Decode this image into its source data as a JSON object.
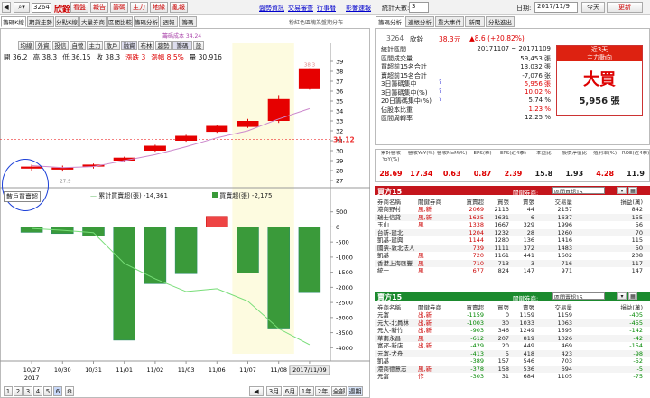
{
  "toolbar": {
    "code": "3264",
    "name": "欣銓",
    "buttons": [
      "看盤",
      "報告",
      "籌碼",
      "主力",
      "地緣",
      "亂報"
    ],
    "links": [
      "盤勢資訊",
      "交易審查",
      "行事曆",
      "影響速報"
    ],
    "days_label": "統計天數:",
    "days": "3",
    "date_label": "日期:",
    "date": "2017/11/9",
    "today": "今天",
    "refresh": "更新"
  },
  "left_tabs": [
    "籌碼K線",
    "期貨走勢",
    "分點K線",
    "大量券商",
    "區間比較",
    "籌碼分析",
    "週報",
    "籌碼"
  ],
  "sub_tabs": [
    "均線",
    "外資",
    "投信",
    "自營",
    "主力",
    "散戶",
    "融資",
    "布林",
    "趨勢",
    "籌碼",
    "設"
  ],
  "ohlc": {
    "open": "開 36.2",
    "high": "高 38.3",
    "low": "低 36.15",
    "close": "收 38.3",
    "change": "漲跌 3",
    "pct": "漲幅 8.5%",
    "vol": "量 30,916"
  },
  "chart_note": "粉紅色區塊為盤期分布",
  "legend_ma": "籌碼成本 34.24",
  "main_y_ticks": [
    "39",
    "38",
    "37",
    "36",
    "35",
    "34",
    "33",
    "32",
    "31",
    "30",
    "29",
    "28",
    "27"
  ],
  "price_marker": "31.12",
  "top_label": "38.3",
  "bottom_label": "27.9",
  "sub_title": "散戶買賣超",
  "sub_leg1": "累計買賣超(張) -14,361",
  "sub_leg2": "買賣超(張) -2,175",
  "sub_y_ticks": [
    "500",
    "0",
    "-500",
    "-1000",
    "-1500",
    "-2000",
    "-2500",
    "-3000",
    "-3500",
    "-4000"
  ],
  "x_labels": [
    "10/27",
    "10/30",
    "10/31",
    "11/01",
    "11/02",
    "11/03",
    "11/06",
    "11/07",
    "11/08",
    "2017/11/09"
  ],
  "x_year": "2017",
  "pages": [
    "1",
    "2",
    "3",
    "4",
    "5",
    "6"
  ],
  "ranges": [
    "3月",
    "6月",
    "1年",
    "2年",
    "全部",
    "週期"
  ],
  "chart_data": [
    {
      "type": "candlestick",
      "x": [
        "10/27",
        "10/30",
        "10/31",
        "11/01",
        "11/02",
        "11/03",
        "11/06",
        "11/07",
        "11/08",
        "11/09"
      ],
      "ohlc": [
        [
          28.4,
          28.6,
          28.0,
          28.2
        ],
        [
          28.3,
          28.5,
          27.9,
          28.1
        ],
        [
          28.4,
          28.7,
          28.2,
          28.6
        ],
        [
          29.0,
          29.4,
          28.9,
          29.3
        ],
        [
          30.0,
          30.6,
          29.9,
          30.5
        ],
        [
          31.0,
          31.6,
          30.9,
          31.5
        ],
        [
          31.9,
          32.6,
          31.8,
          32.5
        ],
        [
          32.4,
          33.2,
          32.3,
          33.0
        ],
        [
          33.0,
          35.6,
          32.8,
          35.2
        ],
        [
          36.2,
          38.3,
          36.15,
          38.3
        ]
      ],
      "ma": [
        28.5,
        28.3,
        28.4,
        29.0,
        29.6,
        30.4,
        31.3,
        32.0,
        33.2,
        34.24
      ],
      "ylim": [
        27,
        39
      ]
    },
    {
      "type": "bar",
      "x": [
        "10/27",
        "10/30",
        "10/31",
        "11/01",
        "11/02",
        "11/03",
        "11/06",
        "11/07",
        "11/08",
        "11/09"
      ],
      "values": [
        -180,
        -220,
        -300,
        -3750,
        -1880,
        -1550,
        350,
        -1520,
        -3350,
        -2175
      ],
      "cumulative": [
        -180,
        -400,
        -700,
        -4450,
        -6330,
        -7880,
        -7530,
        -9050,
        -12400,
        -14361
      ],
      "ylim": [
        -4200,
        700
      ]
    }
  ],
  "info": {
    "tabs": [
      "籌碼分析",
      "連帳分析",
      "重大事件",
      "新聞",
      "分點進出"
    ],
    "code": "3264",
    "name": "欣銓",
    "price": "38.3元",
    "change": "▲8.6 (+20.82%)",
    "rows": [
      [
        "統計區間",
        "20171107 ~ 20171109",
        ""
      ],
      [
        "區間成交量",
        "59,453 張",
        ""
      ],
      [
        "買超前15名合計",
        "13,032 張",
        ""
      ],
      [
        "賣超前15名合計",
        "-7,076 张",
        ""
      ],
      [
        "3日籌碼集中",
        "5,956 張",
        "red"
      ],
      [
        "3日籌碼集中(%)",
        "10.02 %",
        "red"
      ],
      [
        "20日籌碼集中(%)",
        "5.74 %",
        ""
      ],
      [
        "佔股本比重",
        "1.23 %",
        "red"
      ],
      [
        "區間周轉率",
        "12.25 %",
        ""
      ]
    ],
    "box_title": "近3天",
    "box_sub": "主力動向",
    "box_big": "大買",
    "box_val": "5,956 張"
  },
  "metrics": {
    "heads": [
      "累計營收YoY(%)",
      "營收YoY(%)",
      "營收MoM(%)",
      "EPS(季)",
      "EPS(近4季)",
      "本益比",
      "股價淨值比",
      "殖利率(%)",
      "ROE(近4季)"
    ],
    "vals": [
      "28.69",
      "17.34",
      "0.63",
      "0.87",
      "2.39",
      "15.8",
      "1.93",
      "4.28",
      "11.9"
    ]
  },
  "buy": {
    "title": "買方15",
    "sort": "關鍵券商:",
    "sel": "區間買超15",
    "heads": [
      "券商名稱",
      "關鍵券商",
      "買賣超",
      "買張",
      "賣張",
      "交易量",
      "損益(萬)"
    ],
    "rows": [
      [
        "港商野村",
        "風,新",
        "2069",
        "2113",
        "44",
        "2157",
        "842"
      ],
      [
        "瑞士信貸",
        "風,新",
        "1625",
        "1631",
        "6",
        "1637",
        "155"
      ],
      [
        "玉山",
        "風",
        "1338",
        "1667",
        "329",
        "1996",
        "56"
      ],
      [
        "台新-建北",
        "",
        "1204",
        "1232",
        "28",
        "1260",
        "70"
      ],
      [
        "凱基-建興",
        "",
        "1144",
        "1280",
        "136",
        "1416",
        "115"
      ],
      [
        "國票-敦北法人",
        "",
        "739",
        "1111",
        "372",
        "1483",
        "50"
      ],
      [
        "凱基",
        "風",
        "720",
        "1161",
        "441",
        "1602",
        "208"
      ],
      [
        "香港上海匯豐",
        "風",
        "710",
        "713",
        "3",
        "716",
        "117"
      ],
      [
        "統一",
        "風",
        "677",
        "824",
        "147",
        "971",
        "147"
      ]
    ]
  },
  "sell": {
    "title": "賣方15",
    "sort": "關鍵券商:",
    "sel": "區間賣超15",
    "heads": [
      "券商名稱",
      "關鍵券商",
      "買賣超",
      "買張",
      "賣張",
      "交易量",
      "損益(萬)"
    ],
    "rows": [
      [
        "元富",
        "出,新",
        "-1159",
        "0",
        "1159",
        "1159",
        "-405"
      ],
      [
        "元大-北員林",
        "出,新",
        "-1003",
        "30",
        "1033",
        "1063",
        "-455"
      ],
      [
        "元大-新竹",
        "出,新",
        "-903",
        "346",
        "1249",
        "1595",
        "-142"
      ],
      [
        "華南永昌",
        "風",
        "-612",
        "207",
        "819",
        "1026",
        "-42"
      ],
      [
        "富邦-新店",
        "出,新",
        "-429",
        "20",
        "449",
        "469",
        "-154"
      ],
      [
        "元富-犬舟",
        "",
        "-413",
        "5",
        "418",
        "423",
        "-98"
      ],
      [
        "凱基",
        "",
        "-389",
        "157",
        "546",
        "703",
        "-52"
      ],
      [
        "港商德意志",
        "風,新",
        "-378",
        "158",
        "536",
        "694",
        "-5"
      ],
      [
        "元富",
        "作",
        "-303",
        "31",
        "684",
        "1105",
        "-75"
      ]
    ]
  }
}
